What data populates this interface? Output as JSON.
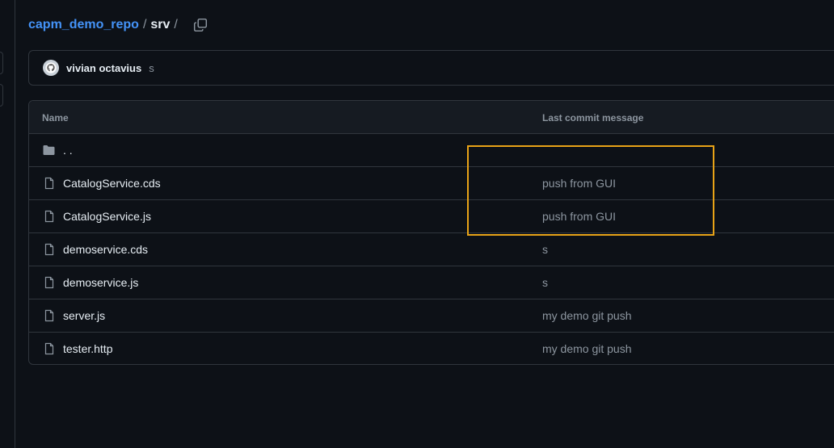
{
  "breadcrumb": {
    "repo": "capm_demo_repo",
    "sep1": "/",
    "dir": "srv",
    "sep2": "/"
  },
  "latest_commit": {
    "author": "vivian octavius",
    "message": "s"
  },
  "table": {
    "col_name": "Name",
    "col_message": "Last commit message",
    "parent_dir": ". .",
    "rows": [
      {
        "name": "CatalogService.cds",
        "message": "push from GUI"
      },
      {
        "name": "CatalogService.js",
        "message": "push from GUI"
      },
      {
        "name": "demoservice.cds",
        "message": "s"
      },
      {
        "name": "demoservice.js",
        "message": "s"
      },
      {
        "name": "server.js",
        "message": "my demo git push"
      },
      {
        "name": "tester.http",
        "message": "my demo git push"
      }
    ]
  },
  "colors": {
    "background": "#0d1117",
    "link": "#4493f8",
    "highlight": "#e8a317"
  }
}
